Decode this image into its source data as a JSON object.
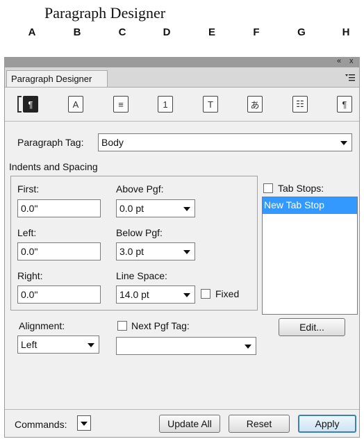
{
  "figure": {
    "title": "Paragraph Designer",
    "callouts": [
      "A",
      "B",
      "C",
      "D",
      "E",
      "F",
      "G",
      "H"
    ]
  },
  "panel": {
    "window_buttons": [
      "«",
      "x"
    ],
    "tab_label": "Paragraph Designer",
    "menu_icon": "panel-menu-icon",
    "property_icons": [
      {
        "name": "basic-properties-icon",
        "glyph": "¶"
      },
      {
        "name": "font-properties-icon",
        "glyph": "A"
      },
      {
        "name": "pagination-properties-icon",
        "glyph": "≡"
      },
      {
        "name": "numbering-properties-icon",
        "glyph": "1"
      },
      {
        "name": "advanced-properties-icon",
        "glyph": "T"
      },
      {
        "name": "asian-properties-icon",
        "glyph": "あ"
      },
      {
        "name": "table-cell-properties-icon",
        "glyph": "☷"
      },
      {
        "name": "direction-properties-icon",
        "glyph": "¶"
      }
    ],
    "paragraph_tag_label": "Paragraph Tag:",
    "paragraph_tag_value": "Body",
    "indents_heading": "Indents and Spacing",
    "first_label": "First:",
    "first_value": "0.0\"",
    "left_label": "Left:",
    "left_value": "0.0\"",
    "right_label": "Right:",
    "right_value": "0.0\"",
    "above_label": "Above Pgf:",
    "above_value": "0.0 pt",
    "below_label": "Below Pgf:",
    "below_value": "3.0 pt",
    "line_space_label": "Line Space:",
    "line_space_value": "14.0 pt",
    "fixed_label": "Fixed",
    "tab_stops_label": "Tab Stops:",
    "tab_stops_items": [
      "New Tab Stop"
    ],
    "edit_label": "Edit...",
    "alignment_label": "Alignment:",
    "alignment_value": "Left",
    "next_tag_label": "Next Pgf Tag:",
    "next_tag_value": "",
    "commands_label": "Commands:",
    "update_all_label": "Update All",
    "reset_label": "Reset",
    "apply_label": "Apply",
    "colors": {
      "selection": "#3399ff",
      "apply_border": "#3c7fb1",
      "titlebar": "#9b9b9b"
    }
  }
}
